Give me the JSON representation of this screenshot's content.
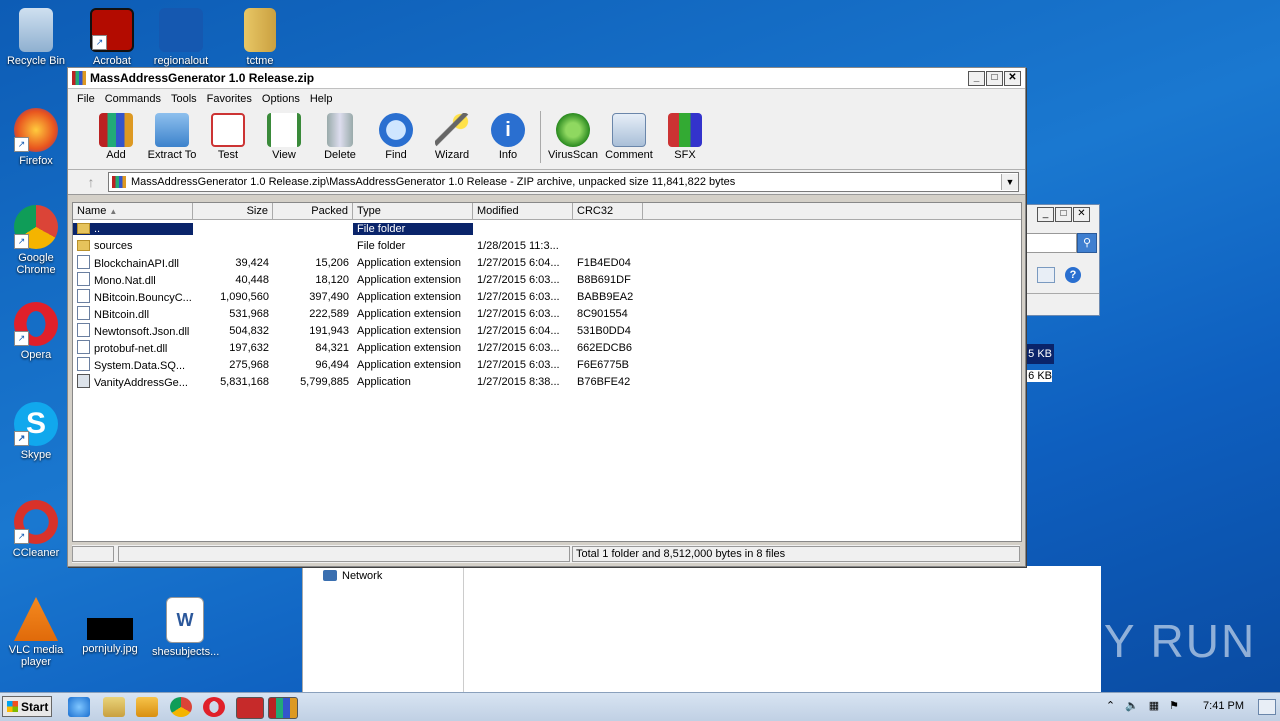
{
  "desktop": {
    "icons": [
      {
        "label": "Recycle Bin"
      },
      {
        "label": "Acrobat"
      },
      {
        "label": "regionalout"
      },
      {
        "label": "tctme"
      },
      {
        "label": "Firefox"
      },
      {
        "label": "Google Chrome"
      },
      {
        "label": "Opera"
      },
      {
        "label": "Skype"
      },
      {
        "label": "CCleaner"
      },
      {
        "label": "VLC media player"
      },
      {
        "label": "pornjuly.jpg"
      },
      {
        "label": "shesubjects..."
      }
    ],
    "bg_window": {
      "size1": "5 KB",
      "size2": "6 KB",
      "network_label": "Network"
    }
  },
  "window": {
    "title": "MassAddressGenerator 1.0 Release.zip",
    "menu": [
      "File",
      "Commands",
      "Tools",
      "Favorites",
      "Options",
      "Help"
    ],
    "toolbar": [
      "Add",
      "Extract To",
      "Test",
      "View",
      "Delete",
      "Find",
      "Wizard",
      "Info",
      "VirusScan",
      "Comment",
      "SFX"
    ],
    "address": "MassAddressGenerator 1.0 Release.zip\\MassAddressGenerator 1.0 Release - ZIP archive, unpacked size 11,841,822 bytes",
    "columns": {
      "name": "Name",
      "size": "Size",
      "packed": "Packed",
      "type": "Type",
      "modified": "Modified",
      "crc": "CRC32"
    },
    "rows": [
      {
        "name": "..",
        "size": "",
        "packed": "",
        "type": "File folder",
        "modified": "",
        "crc": ""
      },
      {
        "name": "sources",
        "size": "",
        "packed": "",
        "type": "File folder",
        "modified": "1/28/2015 11:3...",
        "crc": ""
      },
      {
        "name": "BlockchainAPI.dll",
        "size": "39,424",
        "packed": "15,206",
        "type": "Application extension",
        "modified": "1/27/2015 6:04...",
        "crc": "F1B4ED04"
      },
      {
        "name": "Mono.Nat.dll",
        "size": "40,448",
        "packed": "18,120",
        "type": "Application extension",
        "modified": "1/27/2015 6:03...",
        "crc": "B8B691DF"
      },
      {
        "name": "NBitcoin.BouncyC...",
        "size": "1,090,560",
        "packed": "397,490",
        "type": "Application extension",
        "modified": "1/27/2015 6:03...",
        "crc": "BABB9EA2"
      },
      {
        "name": "NBitcoin.dll",
        "size": "531,968",
        "packed": "222,589",
        "type": "Application extension",
        "modified": "1/27/2015 6:03...",
        "crc": "8C901554"
      },
      {
        "name": "Newtonsoft.Json.dll",
        "size": "504,832",
        "packed": "191,943",
        "type": "Application extension",
        "modified": "1/27/2015 6:04...",
        "crc": "531B0DD4"
      },
      {
        "name": "protobuf-net.dll",
        "size": "197,632",
        "packed": "84,321",
        "type": "Application extension",
        "modified": "1/27/2015 6:03...",
        "crc": "662EDCB6"
      },
      {
        "name": "System.Data.SQ...",
        "size": "275,968",
        "packed": "96,494",
        "type": "Application extension",
        "modified": "1/27/2015 6:03...",
        "crc": "F6E6775B"
      },
      {
        "name": "VanityAddressGe...",
        "size": "5,831,168",
        "packed": "5,799,885",
        "type": "Application",
        "modified": "1/27/2015 8:38...",
        "crc": "B76BFE42"
      }
    ],
    "status": "Total 1 folder and 8,512,000 bytes in 8 files"
  },
  "taskbar": {
    "start": "Start",
    "clock": "7:41 PM"
  },
  "watermark": "ANY RUN"
}
